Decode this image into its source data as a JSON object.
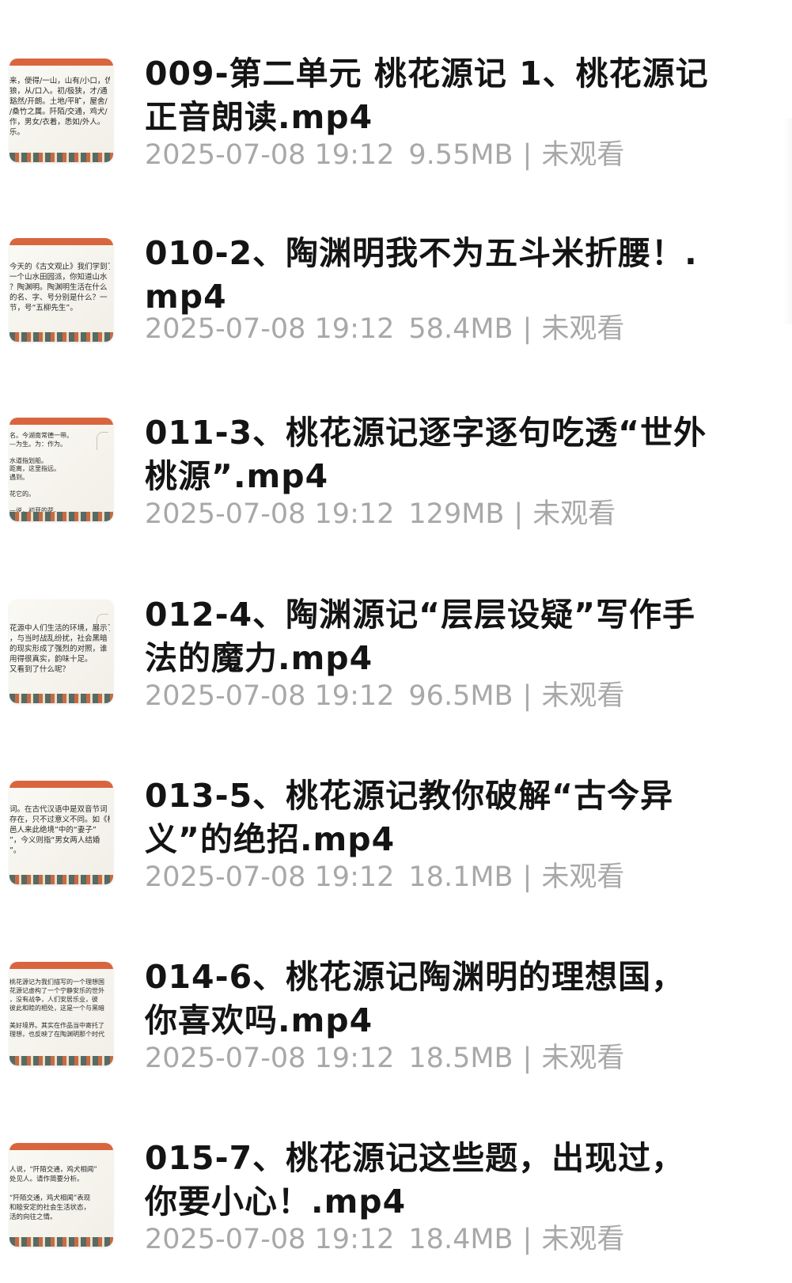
{
  "files": [
    {
      "title": "009-第二单元 桃花源记 1、桃花源记正音朗读.mp4",
      "date": "2025-07-08 19:12",
      "size": "9.55MB",
      "separator": "|",
      "status": "未观看",
      "thumb_text": "来，便得/一山，山有/小口，仿\n狼，从/口入。初/极狭，才/通\n豁然/开朗。土地/平旷，屋舍/\n/桑竹之属。阡陌/交通，鸡犬/\n作，男女/衣着，悉如/外人。\n乐。"
    },
    {
      "title": "010-2、陶渊明我不为五斗米折腰！.mp4",
      "date": "2025-07-08 19:12",
      "size": "58.4MB",
      "separator": "|",
      "status": "未观看",
      "thumb_text": "今天的《古文观止》我们学到了\n一个山水田园派，你知道山水\n？陶渊明。陶渊明生活在什么\n的名、字、号分别是什么？一\n节，号“五柳先生”。"
    },
    {
      "title": "011-3、桃花源记逐字逐句吃透“世外桃源”.mp4",
      "date": "2025-07-08 19:12",
      "size": "129MB",
      "separator": "|",
      "status": "未观看",
      "thumb_text": "名。今湖南常德一带。\n—为生。为：作为。\n\n水道指划船。\n距离，这里指远。\n遇到。\n\n花它的。\n\n—说，初开的花。"
    },
    {
      "title": "012-4、陶渊源记“层层设疑”写作手法的魔力.mp4",
      "date": "2025-07-08 19:12",
      "size": "96.5MB",
      "separator": "|",
      "status": "未观看",
      "thumb_text": "花源中人们生活的环境，展示了\n，与当时战乱纷扰，社会黑暗\n的现实形成了强烈的对照，谁\n用得很真实，韵味十足。\n又看到了什么呢？"
    },
    {
      "title": "013-5、桃花源记教你破解“古今异义”的绝招.mp4",
      "date": "2025-07-08 19:12",
      "size": "18.1MB",
      "separator": "|",
      "status": "未观看",
      "thumb_text": "词。在古代汉语中是双音节词\n存在，只不过意义不同。如《桃\n邑人来此绝境”中的“妻子”\n”，今义则指“男女两人结婚\n”。"
    },
    {
      "title": "014-6、桃花源记陶渊明的理想国，你喜欢吗.mp4",
      "date": "2025-07-08 19:12",
      "size": "18.5MB",
      "separator": "|",
      "status": "未观看",
      "thumb_text": "桃花源记为我们描写的一个理想国\n花源记虚构了一个宁静安乐的世外\n，没有战争，人们安居乐业，彼\n彼此和睦的相处，这是一个与黑暗\n\n美好境界。其实在作品当中寄托了\n理想，也反映了在陶渊明那个时代"
    },
    {
      "title": "015-7、桃花源记这些题，出现过，你要小心！.mp4",
      "date": "2025-07-08 19:12",
      "size": "18.4MB",
      "separator": "|",
      "status": "未观看",
      "thumb_text": "人说，“阡陌交通，鸡犬相闻”\n处见人。请作简要分析。\n\n“阡陌交通，鸡犬相闻”表现\n和睦安定的社会生活状态，\n活的向往之情。"
    }
  ]
}
